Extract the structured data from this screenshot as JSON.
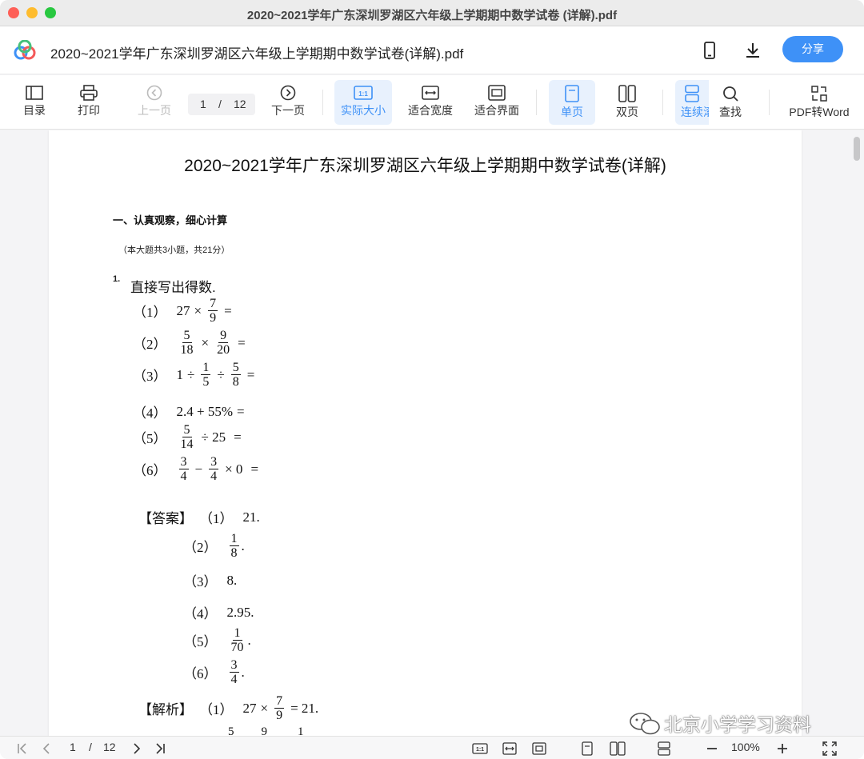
{
  "window": {
    "title": "2020~2021学年广东深圳罗湖区六年级上学期期中数学试卷 (详解).pdf"
  },
  "header": {
    "doc_title": "2020~2021学年广东深圳罗湖区六年级上学期期中数学试卷(详解).pdf",
    "share_label": "分享"
  },
  "toolbar": {
    "toc": "目录",
    "print": "打印",
    "prev": "上一页",
    "page_current": "1",
    "page_sep": "/",
    "page_total": "12",
    "next": "下一页",
    "actual_size": "实际大小",
    "fit_width": "适合宽度",
    "fit_page": "适合界面",
    "single": "单页",
    "double": "双页",
    "continuous": "连续滚",
    "find": "查找",
    "pdf2word": "PDF转Word"
  },
  "document": {
    "title": "2020~2021学年广东深圳罗湖区六年级上学期期中数学试卷(详解)",
    "section": "一、认真观察，细心计算",
    "section_note": "（本大题共3小题，共21分）",
    "q_num": "1.",
    "q_text": "直接写出得数.",
    "items": {
      "l1": "（1）",
      "l2": "（2）",
      "l3": "（3）",
      "l4": "（4）",
      "l5": "（5）",
      "l6": "（6）",
      "q1_a": "27",
      "q1_op": "×",
      "q1_n": "7",
      "q1_d": "9",
      "eq": "=",
      "q2_n1": "5",
      "q2_d1": "18",
      "q2_op": "×",
      "q2_n2": "9",
      "q2_d2": "20",
      "q3_a": "1",
      "q3_op1": "÷",
      "q3_n1": "1",
      "q3_d1": "5",
      "q3_op2": "÷",
      "q3_n2": "5",
      "q3_d2": "8",
      "q4": "2.4 + 55%",
      "q5_n": "5",
      "q5_d": "14",
      "q5_rest": "÷ 25",
      "q6_n1": "3",
      "q6_d1": "4",
      "q6_op": "−",
      "q6_n2": "3",
      "q6_d2": "4",
      "q6_rest": "× 0"
    },
    "answer": {
      "head": "【答案】",
      "a1": "21.",
      "a2_n": "1",
      "a2_d": "8",
      "a3": "8.",
      "a4": "2.95.",
      "a5_n": "1",
      "a5_d": "70",
      "a6_n": "3",
      "a6_d": "4",
      "dot": "."
    },
    "analysis": {
      "head": "【解析】",
      "s1_a": "27",
      "s1_op": "×",
      "s1_n": "7",
      "s1_d": "9",
      "s1_res": "= 21.",
      "s2_partial_1": "5",
      "s2_partial_2": "9",
      "s2_partial_3": "1"
    }
  },
  "watermark": {
    "text": "北京小学学习资料"
  },
  "bottombar": {
    "page_current": "1",
    "page_sep": "/",
    "page_total": "12",
    "zoom": "100%"
  },
  "colors": {
    "accent": "#3e91f7",
    "active_bg": "#e8f1fd"
  }
}
